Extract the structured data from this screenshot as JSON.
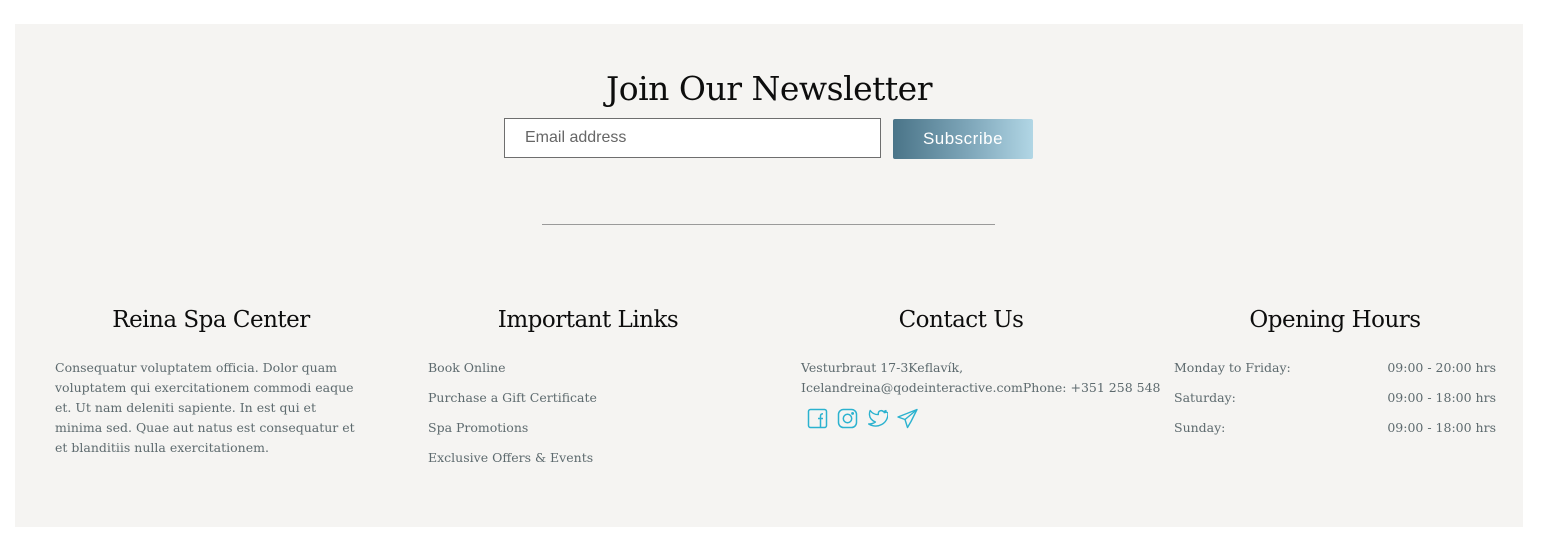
{
  "newsletter": {
    "title": "Join Our Newsletter",
    "email_placeholder": "Email address",
    "subscribe_label": "Subscribe"
  },
  "columns": {
    "about": {
      "heading": "Reina Spa Center",
      "text": "Consequatur voluptatem officia. Dolor quam voluptatem qui exercitationem commodi eaque et. Ut nam deleniti sapiente. In est qui et minima sed. Quae aut natus est consequatur et et blanditiis nulla exercitationem."
    },
    "links": {
      "heading": "Important Links",
      "items": [
        "Book Online",
        "Purchase a Gift Certificate",
        "Spa Promotions",
        "Exclusive Offers & Events"
      ]
    },
    "contact": {
      "heading": "Contact Us",
      "line1": "Vesturbraut 17-3Keflavík,",
      "line2": "Icelandreina@qodeinteractive.comPhone: +351 258 548",
      "socials": [
        "facebook-icon",
        "instagram-icon",
        "twitter-icon",
        "telegram-icon"
      ]
    },
    "hours": {
      "heading": "Opening Hours",
      "rows": [
        {
          "day": "Monday to Friday:",
          "time": "09:00 - 20:00 hrs"
        },
        {
          "day": "Saturday:",
          "time": "09:00 - 18:00 hrs"
        },
        {
          "day": "Sunday:",
          "time": "09:00 - 18:00 hrs"
        }
      ]
    }
  },
  "colors": {
    "background": "#f5f4f2",
    "button_gradient_start": "#4a7488",
    "button_gradient_end": "#b1d6e5",
    "social_icon": "#2bb2cf",
    "body_text": "#5d6a6e"
  }
}
